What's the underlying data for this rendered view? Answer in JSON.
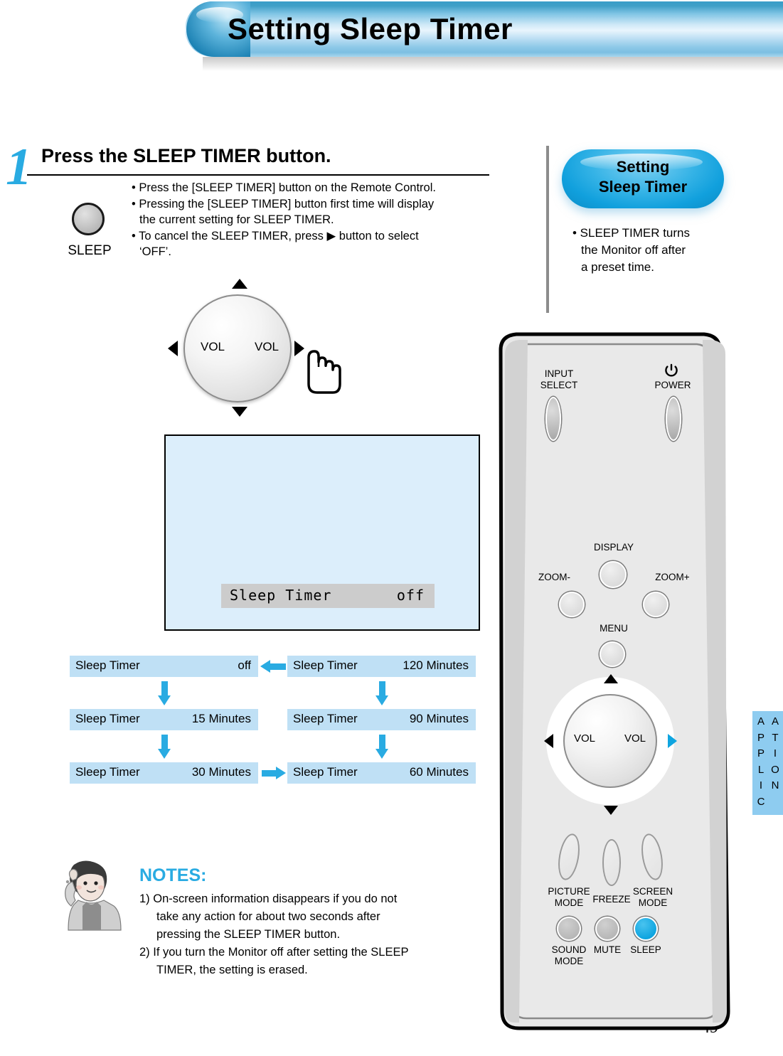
{
  "header": {
    "title": "Setting Sleep Timer"
  },
  "page": {
    "number": "49"
  },
  "step": {
    "number": "1",
    "title": "Press the SLEEP TIMER button.",
    "button_label": "SLEEP",
    "bullets": [
      {
        "mark": "•",
        "lines": [
          "Press the [SLEEP TIMER] button on the Remote Control."
        ]
      },
      {
        "mark": "•",
        "lines": [
          "Pressing the [SLEEP TIMER] button first time will display",
          "the current setting for SLEEP TIMER."
        ]
      },
      {
        "mark": "•",
        "lines": [
          "To cancel the SLEEP TIMER, press ▶ button to select",
          "‘OFF’."
        ]
      }
    ],
    "bullet_flat": [
      "• Press the [SLEEP TIMER] button on the Remote Control.",
      "• Pressing the [SLEEP TIMER] button first time will display",
      "the current setting for SLEEP TIMER.",
      "• To cancel the SLEEP TIMER, press ▶ button to select",
      "‘OFF’."
    ]
  },
  "dial": {
    "vol_left": "VOL",
    "vol_right": "VOL"
  },
  "osd": {
    "label": "Sleep Timer",
    "value": "off"
  },
  "flow": {
    "items": [
      {
        "label": "Sleep Timer",
        "value": "off"
      },
      {
        "label": "Sleep Timer",
        "value": "15 Minutes"
      },
      {
        "label": "Sleep Timer",
        "value": "30 Minutes"
      },
      {
        "label": "Sleep Timer",
        "value": "120 Minutes"
      },
      {
        "label": "Sleep Timer",
        "value": "90 Minutes"
      },
      {
        "label": "Sleep Timer",
        "value": "60 Minutes"
      }
    ]
  },
  "notes": {
    "title": "NOTES:",
    "lines": [
      "1) On-screen information disappears if you do not",
      "take any action for about two seconds after",
      "pressing the SLEEP TIMER button.",
      "2) If you turn the Monitor off after setting the SLEEP",
      "TIMER, the setting is erased."
    ]
  },
  "sidebar": {
    "badge_line1": "Setting",
    "badge_line2": "Sleep Timer",
    "desc_lines": [
      "• SLEEP TIMER turns",
      "the Monitor off after",
      "a preset time."
    ]
  },
  "side_tab": {
    "col1": "APPLIC",
    "col2": "ATION",
    "full": "APPLICATION"
  },
  "remote": {
    "input_select_l1": "INPUT",
    "input_select_l2": "SELECT",
    "power": "POWER",
    "display": "DISPLAY",
    "zoom_minus": "ZOOM-",
    "zoom_plus": "ZOOM+",
    "menu": "MENU",
    "vol_left": "VOL",
    "vol_right": "VOL",
    "picture_mode_l1": "PICTURE",
    "picture_mode_l2": "MODE",
    "freeze": "FREEZE",
    "screen_mode_l1": "SCREEN",
    "screen_mode_l2": "MODE",
    "sound_mode_l1": "SOUND",
    "sound_mode_l2": "MODE",
    "mute": "MUTE",
    "sleep": "SLEEP"
  },
  "colors": {
    "accent": "#29ABE2",
    "osd_bg": "#dceefb",
    "flow_box": "#bfe0f5",
    "sleep_key": "#0FA5E0",
    "tab": "#8ECCF0"
  }
}
